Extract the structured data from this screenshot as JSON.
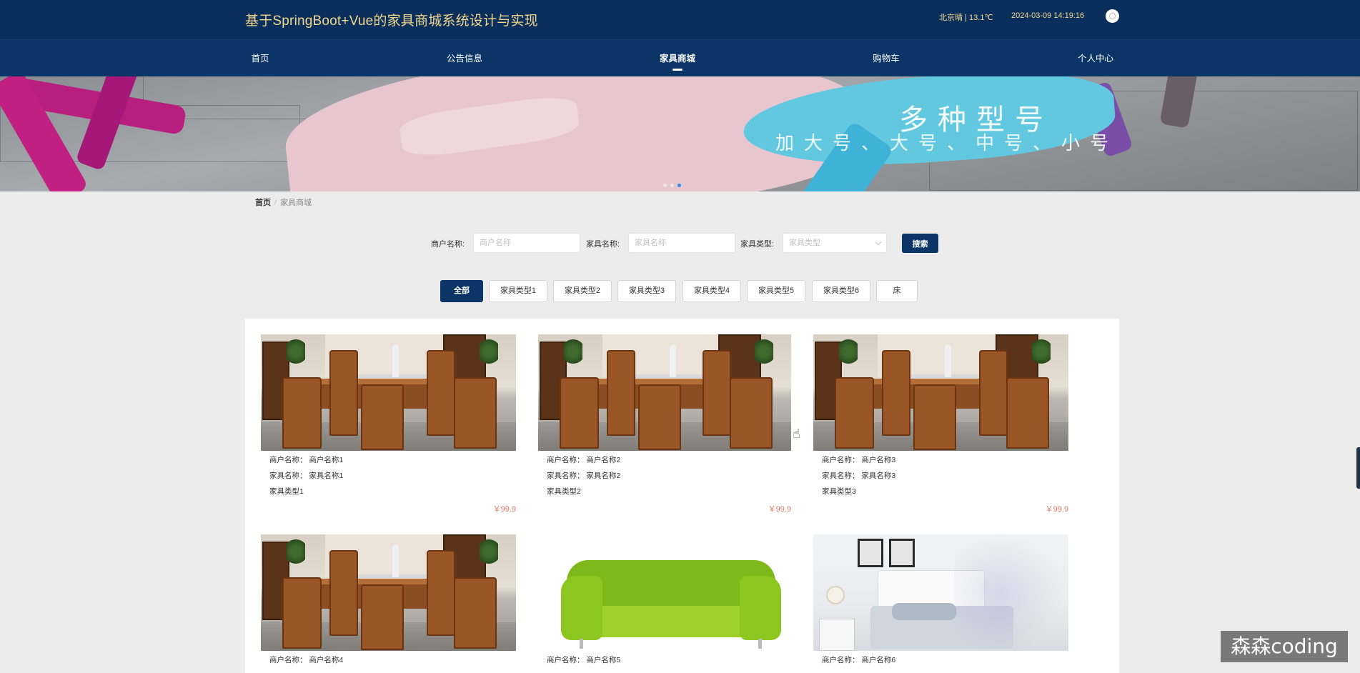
{
  "header": {
    "title": "基于SpringBoot+Vue的家具商城系统设计与实现",
    "weather": "北京晴 | 13.1℃",
    "datetime": "2024-03-09  14:19:16"
  },
  "nav": {
    "items": [
      {
        "label": "首页"
      },
      {
        "label": "公告信息"
      },
      {
        "label": "家具商城",
        "active": true
      },
      {
        "label": "购物车"
      },
      {
        "label": "个人中心"
      }
    ]
  },
  "banner": {
    "title": "多种型号",
    "subtitle": "加大号、大号、中号、小号",
    "active_slide": 3,
    "slide_count": 3
  },
  "breadcrumb": {
    "home": "首页",
    "current": "家具商城"
  },
  "search": {
    "merchant_label": "商户名称:",
    "merchant_placeholder": "商户名称",
    "furniture_label": "家具名称:",
    "furniture_placeholder": "家具名称",
    "type_label": "家具类型:",
    "type_placeholder": "家具类型",
    "button": "搜索"
  },
  "categories": [
    "全部",
    "家具类型1",
    "家具类型2",
    "家具类型3",
    "家具类型4",
    "家具类型5",
    "家具类型6",
    "床"
  ],
  "products": [
    {
      "merchant": "商户名称：  商户名称1",
      "name": "家具名称：  家具名称1",
      "type": "家具类型1",
      "price": "￥99.9",
      "image": "dining-set"
    },
    {
      "merchant": "商户名称：  商户名称2",
      "name": "家具名称：  家具名称2",
      "type": "家具类型2",
      "price": "￥99.9",
      "image": "dining-set"
    },
    {
      "merchant": "商户名称：  商户名称3",
      "name": "家具名称：  家具名称3",
      "type": "家具类型3",
      "price": "￥99.9",
      "image": "dining-set"
    },
    {
      "merchant": "商户名称：  商户名称4",
      "image": "dining-set"
    },
    {
      "merchant": "商户名称：  商户名称5",
      "image": "green-sofa"
    },
    {
      "merchant": "商户名称：  商户名称6",
      "image": "bedroom"
    }
  ],
  "watermark": "森森coding",
  "colors": {
    "header_bg": "#0a2f5c",
    "nav_bg": "#0a3566",
    "title_gold": "#f1d78c",
    "price": "#e07a5f"
  }
}
